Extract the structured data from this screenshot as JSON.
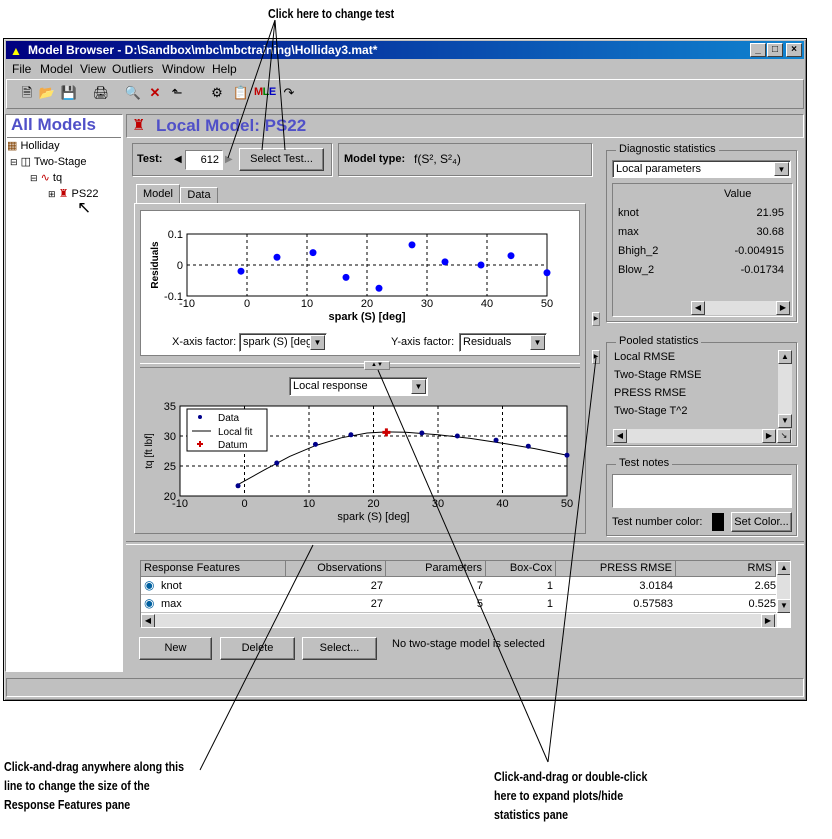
{
  "annotations": {
    "change_test": "Click here to change test",
    "drag_line": [
      "Click-and-drag anywhere along this",
      "line to change the size of the",
      "Response Features pane"
    ],
    "expand_plots": [
      "Click-and-drag or double-click",
      "here to expand plots/hide",
      "statistics pane"
    ]
  },
  "window": {
    "title": "Model Browser - D:\\Sandbox\\mbc\\mbctraining\\Holliday3.mat*",
    "menu": [
      "File",
      "Model",
      "View",
      "Outliers",
      "Window",
      "Help"
    ],
    "toolbar_mle": "MLE"
  },
  "tree": {
    "header": "All Models",
    "items": [
      {
        "label": "Holliday"
      },
      {
        "label": "Two-Stage"
      },
      {
        "label": "tq"
      },
      {
        "label": "PS22"
      }
    ]
  },
  "main": {
    "title": "Local Model: PS22",
    "test_label": "Test:",
    "test_value": "612",
    "select_test": "Select Test...",
    "model_type_label": "Model type:",
    "model_type_value": "f(S², S²₄)",
    "tabs": [
      "Model",
      "Data"
    ],
    "x_axis_factor_label": "X-axis factor:",
    "x_axis_factor_value": "spark (S) [deg",
    "y_axis_factor_label": "Y-axis factor:",
    "y_axis_factor_value": "Residuals",
    "response_dropdown": "Local response"
  },
  "diagnostics": {
    "title": "Diagnostic statistics",
    "dropdown": "Local parameters",
    "value_header": "Value",
    "rows": [
      {
        "name": "knot",
        "value": "21.95"
      },
      {
        "name": "max",
        "value": "30.68"
      },
      {
        "name": "Bhigh_2",
        "value": "-0.004915"
      },
      {
        "name": "Blow_2",
        "value": "-0.01734"
      }
    ]
  },
  "pooled": {
    "title": "Pooled statistics",
    "items": [
      "Local RMSE",
      "Two-Stage RMSE",
      "PRESS RMSE",
      "Two-Stage T^2"
    ]
  },
  "notes": {
    "title": "Test notes",
    "color_label": "Test number color:",
    "set_color": "Set Color..."
  },
  "features": {
    "columns": [
      "Response Features",
      "Observations",
      "Parameters",
      "Box-Cox",
      "PRESS RMSE",
      "RMS"
    ],
    "rows": [
      [
        "knot",
        "27",
        "7",
        "1",
        "3.0184",
        "2.65"
      ],
      [
        "max",
        "27",
        "5",
        "1",
        "0.57583",
        "0.525"
      ]
    ],
    "buttons": {
      "new": "New",
      "delete": "Delete",
      "select": "Select..."
    },
    "status": "No two-stage model is selected"
  },
  "colors": {
    "title_blue": "#5050c8",
    "marker": "#0000ff",
    "datum": "#cc0000"
  },
  "chart_data": [
    {
      "type": "scatter",
      "xlabel": "spark (S) [deg]",
      "ylabel": "Residuals",
      "xlim": [
        -10,
        50
      ],
      "ylim": [
        -0.1,
        0.1
      ],
      "xticks": [
        "-10",
        "0",
        "10",
        "20",
        "30",
        "40",
        "50"
      ],
      "yticks": [
        "-0.1",
        "0",
        "0.1"
      ],
      "grid": true,
      "x": [
        -1,
        5,
        11,
        16.5,
        22,
        27.5,
        33,
        39,
        44,
        50
      ],
      "y": [
        -0.02,
        0.025,
        0.04,
        -0.04,
        -0.075,
        0.065,
        0.01,
        0,
        0.03,
        -0.025
      ]
    },
    {
      "type": "line",
      "xlabel": "spark (S) [deg]",
      "ylabel": "tq [ft lbf]",
      "xlim": [
        -10,
        50
      ],
      "ylim": [
        20,
        35
      ],
      "xticks": [
        "-10",
        "0",
        "10",
        "20",
        "30",
        "40",
        "50"
      ],
      "yticks": [
        "20",
        "25",
        "30",
        "35"
      ],
      "grid": true,
      "legend": [
        "Data",
        "Local fit",
        "Datum"
      ],
      "legend_position": "top-left",
      "data_x": [
        -1,
        5,
        11,
        16.5,
        27.5,
        33,
        39,
        44,
        50
      ],
      "data_y": [
        21.7,
        25.5,
        28.6,
        30.2,
        30.5,
        30.0,
        29.3,
        28.3,
        26.8
      ],
      "fit_x": [
        -1,
        3,
        7,
        11,
        15,
        19,
        21.95,
        25,
        30,
        35,
        40,
        45,
        50
      ],
      "fit_y": [
        21.9,
        24.3,
        26.6,
        28.4,
        29.7,
        30.5,
        30.68,
        30.62,
        30.2,
        29.6,
        28.8,
        27.9,
        26.8
      ],
      "datum": {
        "x": 22,
        "y": 30.6
      }
    }
  ]
}
